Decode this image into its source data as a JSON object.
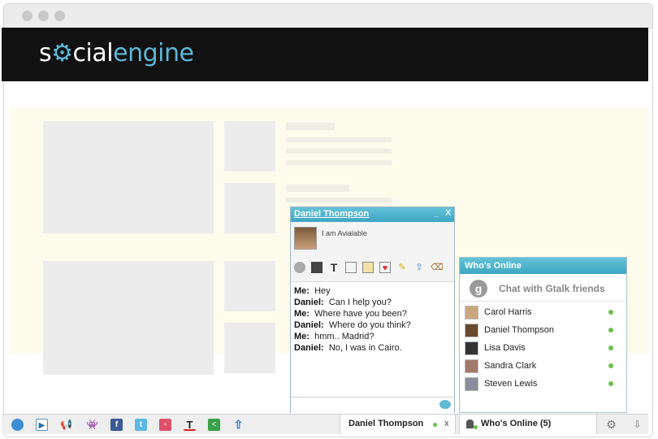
{
  "brand": {
    "part1": "s",
    "gear": "⚙",
    "part2": "cial",
    "part3": "engine"
  },
  "chat": {
    "contact": "Daniel Thompson",
    "status": "I am Avialable",
    "minimize": "_",
    "close": "X",
    "messages": [
      {
        "who": "Me:",
        "text": "Hey"
      },
      {
        "who": "Daniel:",
        "text": "Can I help you?"
      },
      {
        "who": "Me:",
        "text": "Where have you been?"
      },
      {
        "who": "Daniel:",
        "text": "Where do you think?"
      },
      {
        "who": "Me:",
        "text": "hmm.. Madrid?"
      },
      {
        "who": "Daniel:",
        "text": "No, I was in Cairo."
      }
    ]
  },
  "online": {
    "title": "Who's Online",
    "gtalk_label": "Chat with Gtalk friends",
    "g_letter": "g",
    "friends": [
      {
        "name": "Carol Harris",
        "color": "#c9a77c"
      },
      {
        "name": "Daniel Thompson",
        "color": "#6a4a2e"
      },
      {
        "name": "Lisa Davis",
        "color": "#333333"
      },
      {
        "name": "Sandra Clark",
        "color": "#a07a6a"
      },
      {
        "name": "Steven Lewis",
        "color": "#8c8c9a"
      }
    ]
  },
  "dock": {
    "chat_tab": "Daniel Thompson",
    "chat_tab_close": "x",
    "online_tab": "Who's Online (5)",
    "icons": [
      "globe-icon",
      "video-icon",
      "megaphone-icon",
      "invader-icon",
      "facebook-icon",
      "twitter-icon",
      "window-icon",
      "text-icon",
      "share-icon",
      "upload-icon"
    ]
  }
}
